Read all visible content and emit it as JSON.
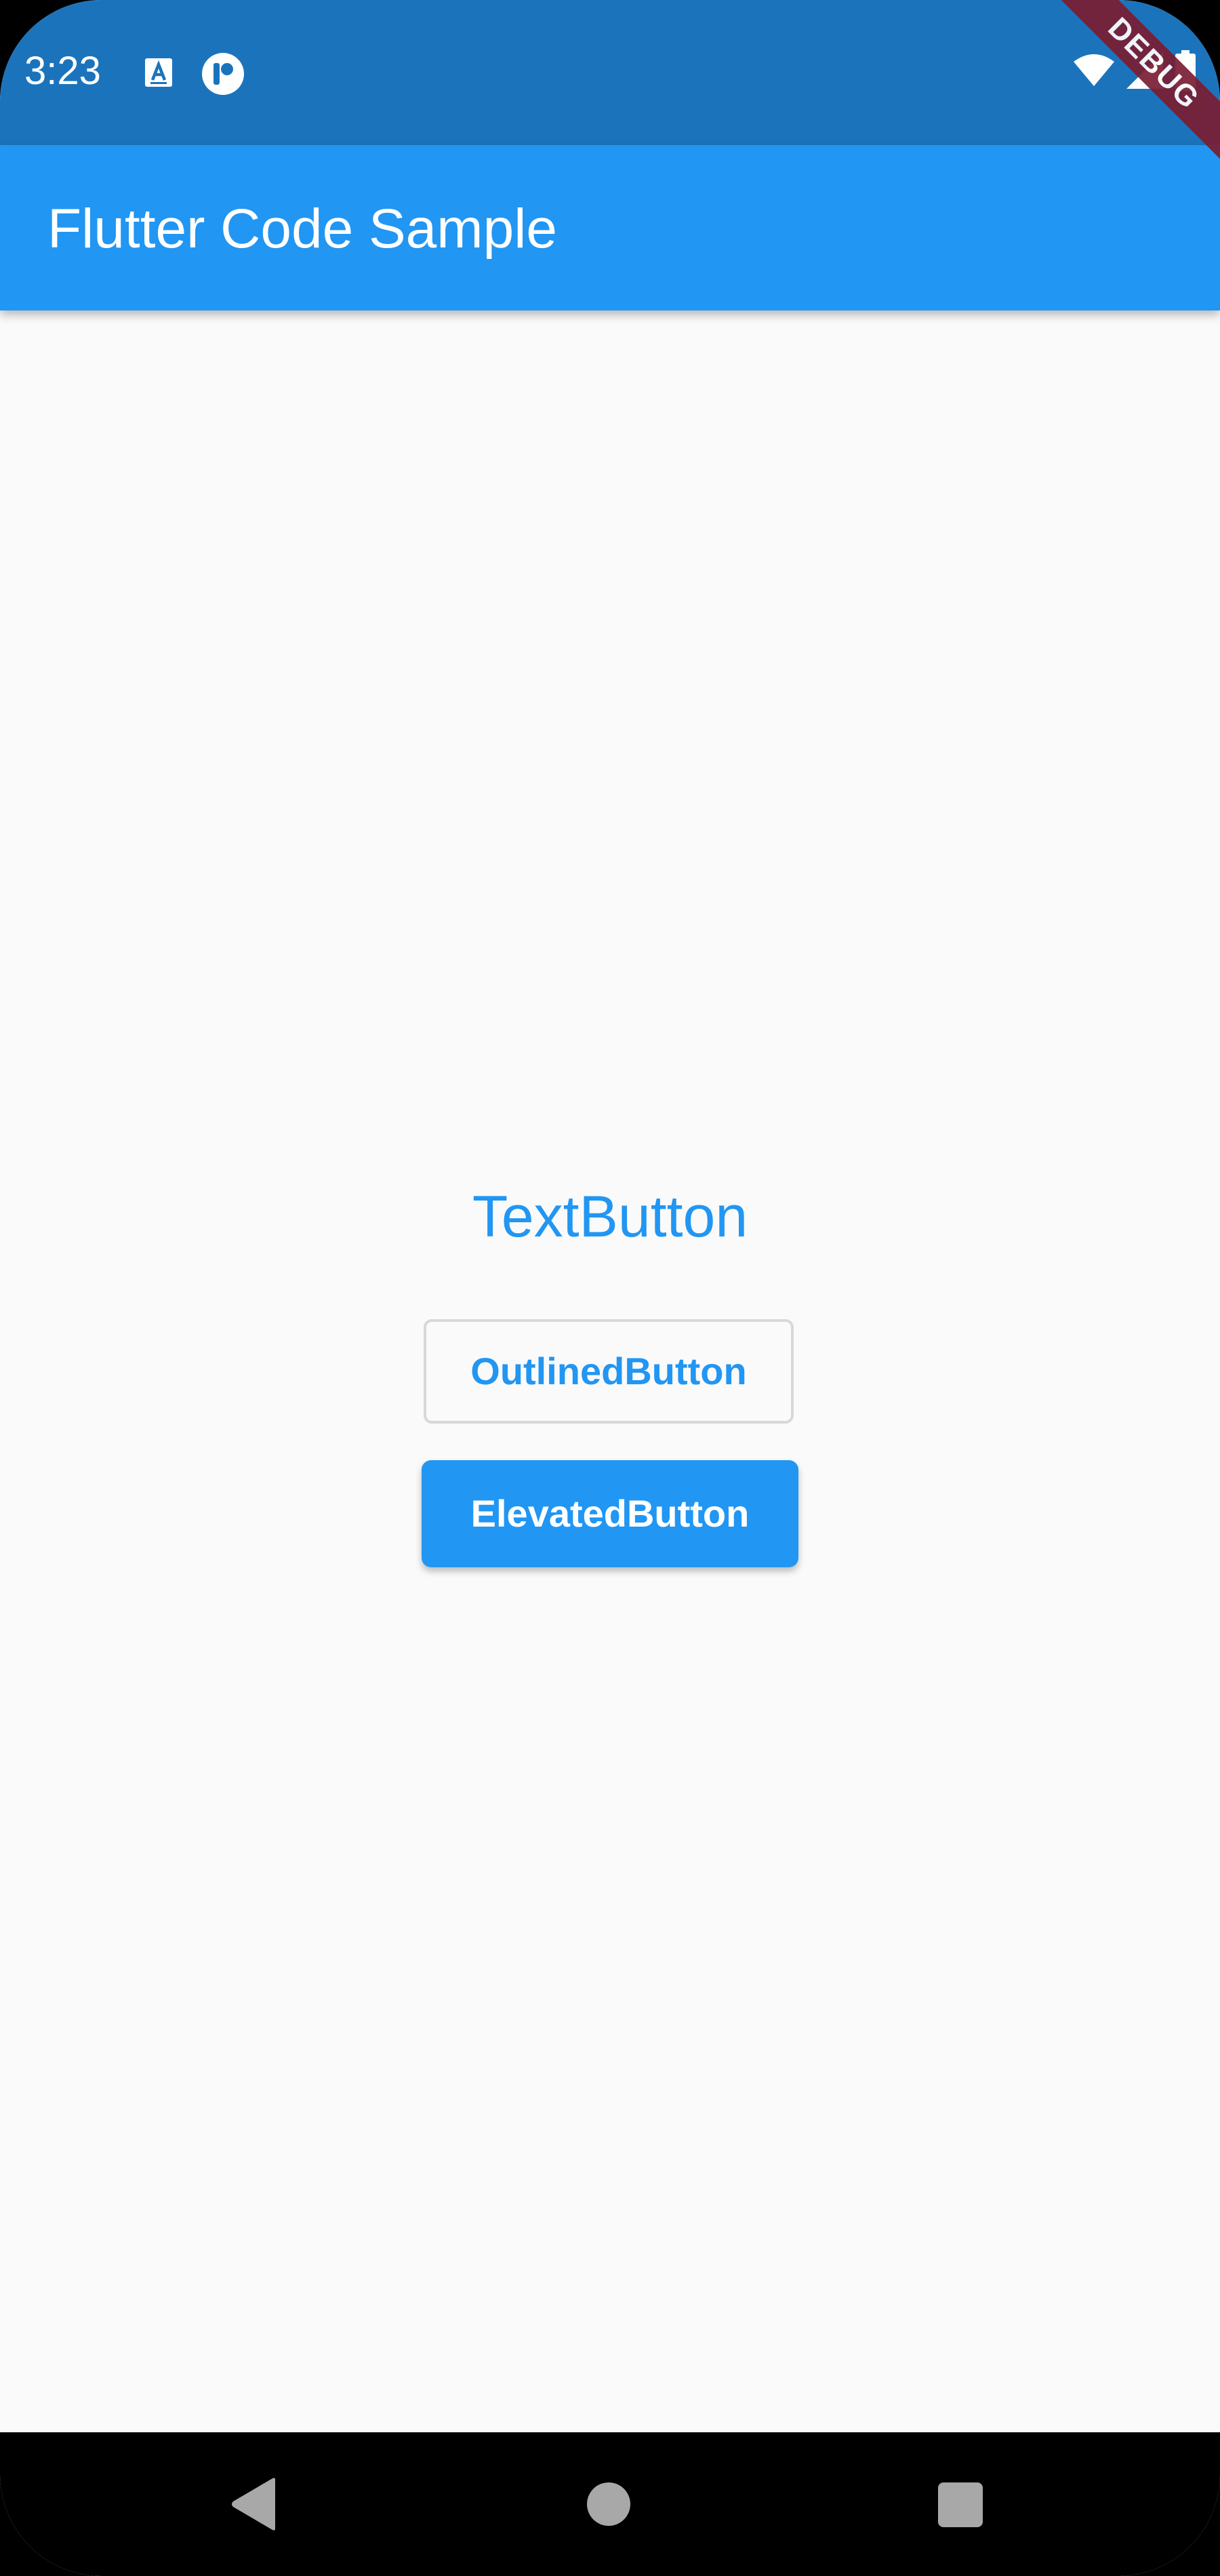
{
  "status_bar": {
    "time": "3:23",
    "icons_left": [
      "text-a-icon",
      "pocket-p-icon"
    ],
    "icons_right": [
      "wifi-icon",
      "cell-signal-icon",
      "battery-icon"
    ],
    "debug_label": "DEBUG",
    "color": "#1b74bb"
  },
  "app_bar": {
    "title": "Flutter Code Sample",
    "color": "#2196f3"
  },
  "buttons": {
    "text_button": "TextButton",
    "outlined_button": "OutlinedButton",
    "elevated_button": "ElevatedButton"
  },
  "nav_bar": {
    "icons": [
      "back-triangle-icon",
      "home-circle-icon",
      "recents-square-icon"
    ]
  },
  "colors": {
    "primary": "#2196f3",
    "status_bar": "#1b74bb",
    "background": "#fafafa",
    "debug_banner": "#7a1e33"
  }
}
